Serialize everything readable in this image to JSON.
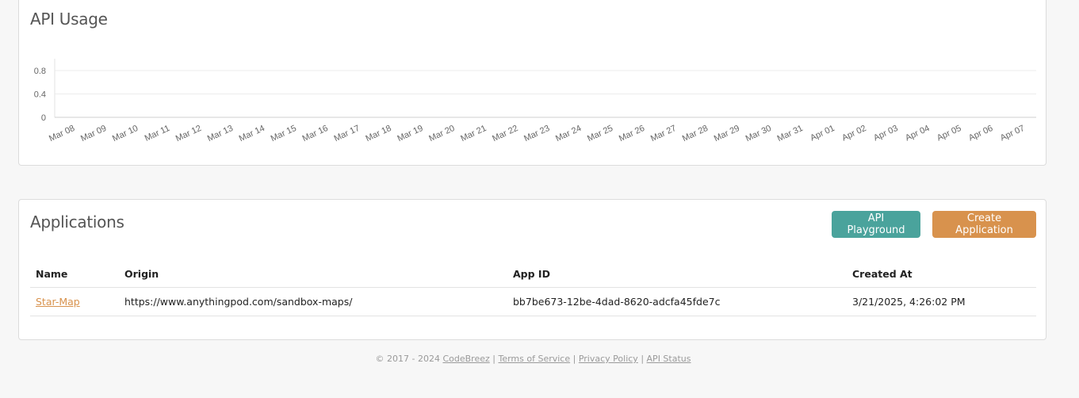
{
  "usage": {
    "title": "API Usage"
  },
  "chart_data": {
    "type": "line",
    "title": "",
    "xlabel": "",
    "ylabel": "",
    "y_ticks": [
      "0",
      "0.4",
      "0.8"
    ],
    "ylim": [
      0,
      1
    ],
    "grid": true,
    "categories": [
      "Mar 08",
      "Mar 09",
      "Mar 10",
      "Mar 11",
      "Mar 12",
      "Mar 13",
      "Mar 14",
      "Mar 15",
      "Mar 16",
      "Mar 17",
      "Mar 18",
      "Mar 19",
      "Mar 20",
      "Mar 21",
      "Mar 22",
      "Mar 23",
      "Mar 24",
      "Mar 25",
      "Mar 26",
      "Mar 27",
      "Mar 28",
      "Mar 29",
      "Mar 30",
      "Mar 31",
      "Apr 01",
      "Apr 02",
      "Apr 03",
      "Apr 04",
      "Apr 05",
      "Apr 06",
      "Apr 07"
    ],
    "series": []
  },
  "applications": {
    "title": "Applications",
    "playground_label": "API Playground",
    "create_label": "Create Application",
    "columns": [
      "Name",
      "Origin",
      "App ID",
      "Created At"
    ],
    "rows": [
      {
        "name": "Star-Map",
        "origin": "https://www.anythingpod.com/sandbox-maps/",
        "app_id": "bb7be673-12be-4dad-8620-adcfa45fde7c",
        "created_at": "3/21/2025, 4:26:02 PM"
      }
    ]
  },
  "footer": {
    "copyright": "© 2017 - 2024",
    "company": "CodeBreez",
    "terms": "Terms of Service",
    "privacy": "Privacy Policy",
    "status": "API Status",
    "separator": "|"
  }
}
